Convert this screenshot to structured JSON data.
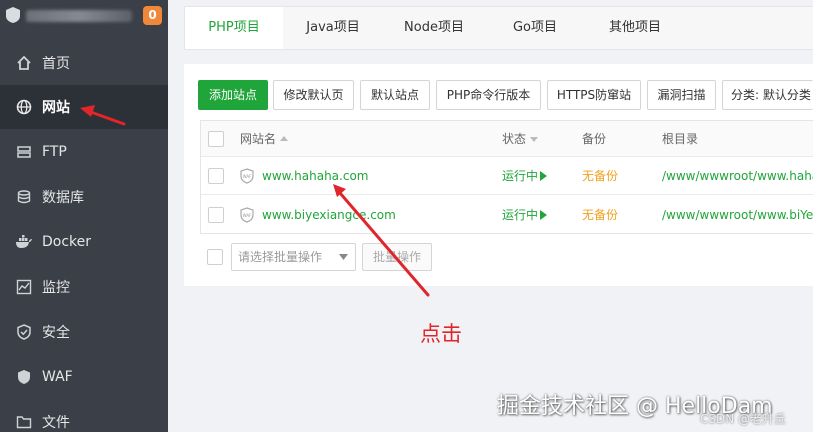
{
  "sidebar": {
    "badge": "0",
    "items": [
      {
        "label": "首页",
        "icon": "home-icon"
      },
      {
        "label": "网站",
        "icon": "globe-icon"
      },
      {
        "label": "FTP",
        "icon": "ftp-icon"
      },
      {
        "label": "数据库",
        "icon": "database-icon"
      },
      {
        "label": "Docker",
        "icon": "docker-icon"
      },
      {
        "label": "监控",
        "icon": "monitor-icon"
      },
      {
        "label": "安全",
        "icon": "shield-icon"
      },
      {
        "label": "WAF",
        "icon": "waf-shield-icon"
      },
      {
        "label": "文件",
        "icon": "folder-icon"
      }
    ]
  },
  "tabs": [
    "PHP项目",
    "Java项目",
    "Node项目",
    "Go项目",
    "其他项目"
  ],
  "toolbar": {
    "buttons": [
      "添加站点",
      "修改默认页",
      "默认站点",
      "PHP命令行版本",
      "HTTPS防窜站",
      "漏洞扫描",
      "分类: 默认分类"
    ]
  },
  "table": {
    "headers": {
      "name": "网站名",
      "status": "状态",
      "backup": "备份",
      "root": "根目录"
    },
    "rows": [
      {
        "name": "www.hahaha.com",
        "status": "运行中",
        "backup": "无备份",
        "root": "/www/wwwroot/www.haha"
      },
      {
        "name": "www.biyexiangce.com",
        "status": "运行中",
        "backup": "无备份",
        "root": "/www/wwwroot/www.biYe"
      }
    ]
  },
  "batch": {
    "placeholder": "请选择批量操作",
    "button": "批量操作"
  },
  "annotation": "点击",
  "watermark": "掘金技术社区 @ HelloDam",
  "watermark_small": "CSDN @老升丘",
  "colors": {
    "accent": "#20a53a",
    "sidebar": "#3b4048",
    "annotation": "#e0262a",
    "backup": "#f0a020"
  }
}
